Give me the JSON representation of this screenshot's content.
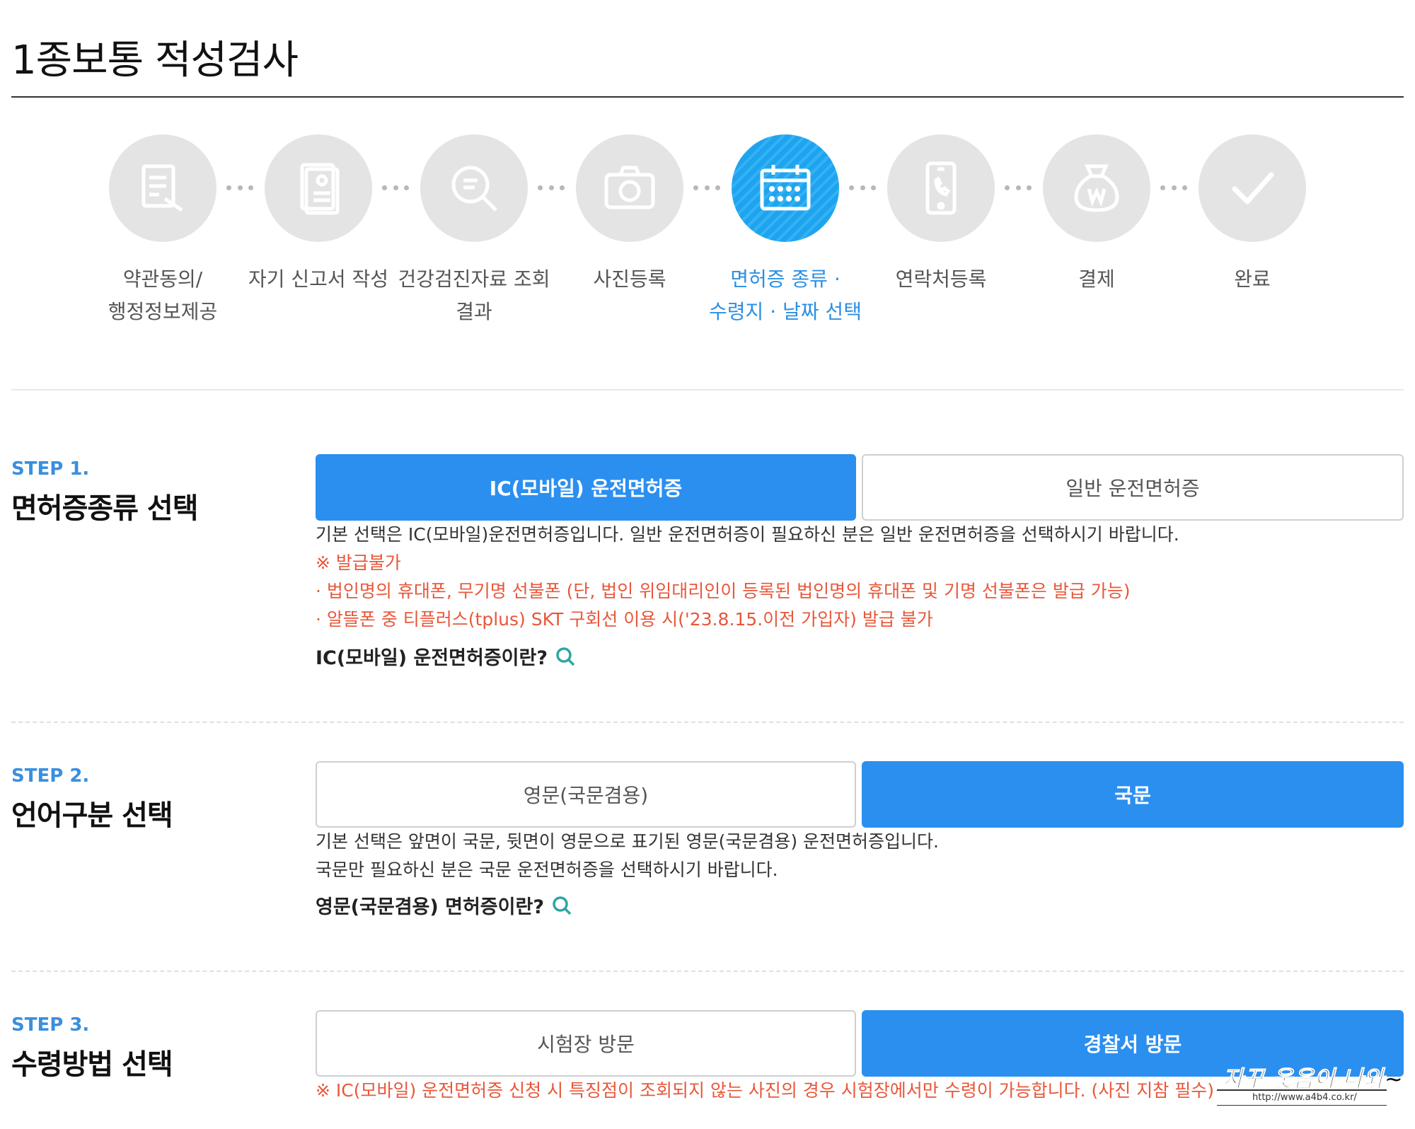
{
  "page": {
    "title": "1종보통 적성검사"
  },
  "progress": {
    "steps": [
      {
        "label1": "약관동의/",
        "label2": "행정정보제공",
        "icon": "document-edit-icon"
      },
      {
        "label1": "자기 신고서 작성",
        "label2": "",
        "icon": "self-report-icon"
      },
      {
        "label1": "건강검진자료 조회",
        "label2": "결과",
        "icon": "search-document-icon"
      },
      {
        "label1": "사진등록",
        "label2": "",
        "icon": "camera-icon"
      },
      {
        "label1": "면허증 종류 ·",
        "label2": "수령지 · 날짜 선택",
        "icon": "calendar-icon",
        "active": true
      },
      {
        "label1": "연락처등록",
        "label2": "",
        "icon": "phone-icon"
      },
      {
        "label1": "결제",
        "label2": "",
        "icon": "payment-bag-icon"
      },
      {
        "label1": "완료",
        "label2": "",
        "icon": "check-icon"
      }
    ]
  },
  "step1": {
    "no": "STEP 1.",
    "title": "면허증종류 선택",
    "options": [
      "IC(모바일) 운전면허증",
      "일반 운전면허증"
    ],
    "selected": 0,
    "desc": "기본 선택은 IC(모바일)운전면허증입니다. 일반 운전면허증이 필요하신 분은 일반 운전면허증을 선택하시기 바랍니다.",
    "notes": [
      "※ 발급불가",
      "· 법인명의 휴대폰, 무기명 선불폰 (단, 법인 위임대리인이 등록된 법인명의 휴대폰 및 기명 선불폰은 발급 가능)",
      "· 알뜰폰 중 티플러스(tplus) SKT 구회선 이용 시('23.8.15.이전 가입자) 발급 불가"
    ],
    "link": "IC(모바일) 운전면허증이란?"
  },
  "step2": {
    "no": "STEP 2.",
    "title": "언어구분 선택",
    "options": [
      "영문(국문겸용)",
      "국문"
    ],
    "selected": 1,
    "desc1": "기본 선택은 앞면이 국문, 뒷면이 영문으로 표기된 영문(국문겸용) 운전면허증입니다.",
    "desc2": "국문만 필요하신 분은 국문 운전면허증을 선택하시기 바랍니다.",
    "link": "영문(국문겸용) 면허증이란?"
  },
  "step3": {
    "no": "STEP 3.",
    "title": "수령방법 선택",
    "options": [
      "시험장 방문",
      "경찰서 방문"
    ],
    "selected": 1,
    "note": "※ IC(모바일) 운전면허증 신청 시 특징점이 조회되지 않는 사진의 경우 시험장에서만 수령이 가능합니다. (사진 지참 필수)"
  },
  "watermark": {
    "text": "자꾸 웃음이 나와~",
    "url": "http://www.a4b4.co.kr/"
  },
  "colors": {
    "accent": "#2b8ff0",
    "active_step": "#1ea4ef",
    "warning": "#e8573a",
    "step_label": "#3a8fde"
  }
}
